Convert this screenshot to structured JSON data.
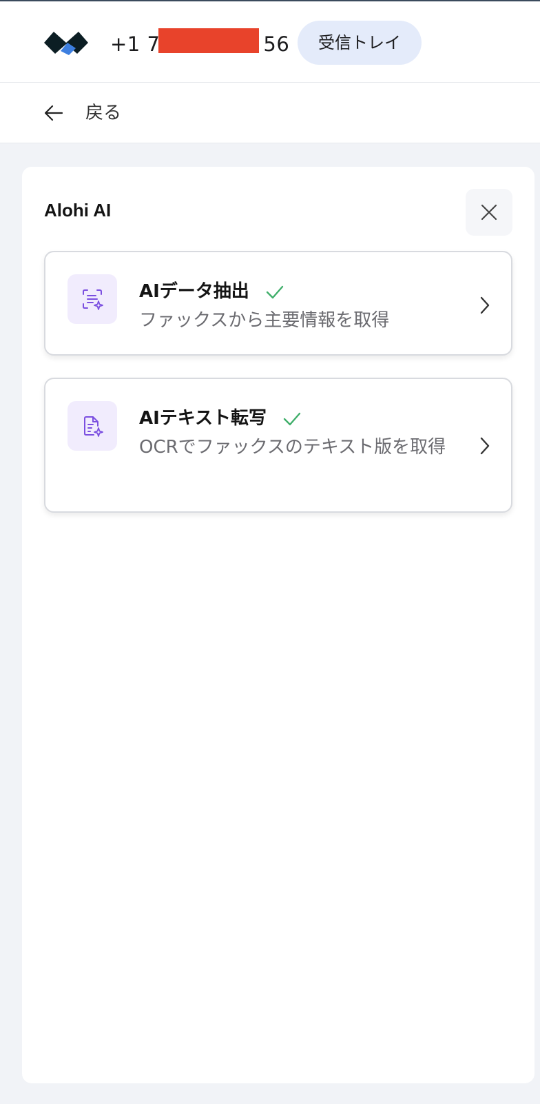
{
  "header": {
    "phone_prefix": "+1 7",
    "phone_suffix": "56",
    "inbox_label": "受信トレイ"
  },
  "nav": {
    "back_label": "戻る"
  },
  "panel": {
    "title": "Alohi AI",
    "cards": [
      {
        "title": "AIデータ抽出",
        "subtitle": "ファックスから主要情報を取得",
        "icon": "scan-sparkle-icon",
        "status": "enabled"
      },
      {
        "title": "AIテキスト転写",
        "subtitle": "OCRでファックスのテキスト版を取得",
        "icon": "document-sparkle-icon",
        "status": "enabled"
      }
    ]
  },
  "colors": {
    "accent": "#7b4fe0",
    "check": "#3fae6a",
    "redaction": "#e8432b",
    "inbox_pill": "#e4ebfa"
  }
}
